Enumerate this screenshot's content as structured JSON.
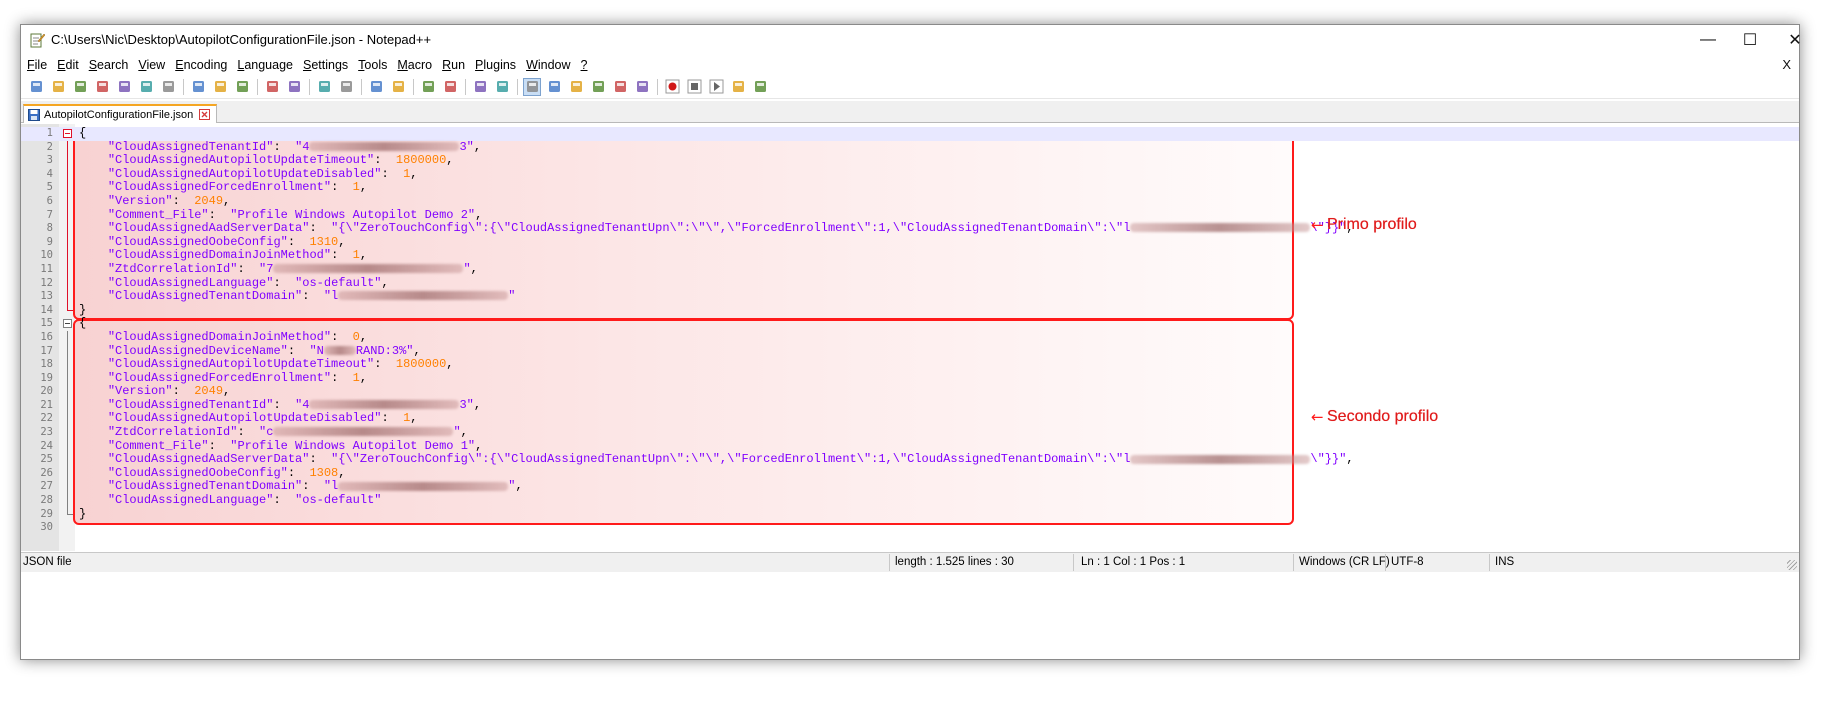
{
  "window": {
    "title": "C:\\Users\\Nic\\Desktop\\AutopilotConfigurationFile.json - Notepad++",
    "minimize": "—",
    "maximize": "☐",
    "close": "✕",
    "doc_close": "X"
  },
  "menu": [
    {
      "u": "F",
      "rest": "ile"
    },
    {
      "u": "E",
      "rest": "dit"
    },
    {
      "u": "S",
      "rest": "earch"
    },
    {
      "u": "V",
      "rest": "iew"
    },
    {
      "u": "E",
      "rest": "ncoding"
    },
    {
      "u": "L",
      "rest": "anguage"
    },
    {
      "u": "S",
      "rest": "ettings"
    },
    {
      "u": "T",
      "rest": "ools"
    },
    {
      "u": "M",
      "rest": "acro"
    },
    {
      "u": "R",
      "rest": "un"
    },
    {
      "u": "P",
      "rest": "lugins"
    },
    {
      "u": "W",
      "rest": "indow"
    },
    {
      "u": "?",
      "rest": ""
    }
  ],
  "toolbar_icons": [
    "new-file-icon",
    "open-file-icon",
    "save-icon",
    "save-all-icon",
    "close-icon",
    "close-all-icon",
    "print-icon",
    "|",
    "cut-icon",
    "copy-icon",
    "paste-icon",
    "|",
    "undo-icon",
    "redo-icon",
    "|",
    "find-icon",
    "replace-icon",
    "|",
    "zoom-in-icon",
    "zoom-out-icon",
    "|",
    "sync-vertical-icon",
    "sync-horizontal-icon",
    "|",
    "word-wrap-icon",
    "show-all-chars-icon",
    "|",
    "indent-guide-icon",
    "udl-icon",
    "doc-map-icon",
    "function-list-icon",
    "folder-workspace-icon",
    "monitor-icon",
    "|",
    "record-macro-icon",
    "stop-macro-icon",
    "play-macro-icon",
    "run-macro-multiple-icon",
    "save-macro-icon"
  ],
  "tab": {
    "label": "AutopilotConfigurationFile.json"
  },
  "code_lines": [
    [
      [
        "p",
        "{"
      ]
    ],
    [
      [
        "p",
        "    "
      ],
      [
        "k",
        "\"CloudAssignedTenantId\""
      ],
      [
        "p",
        ":  "
      ],
      [
        "k",
        "\"4"
      ],
      [
        "blur",
        "150"
      ],
      [
        "k",
        "3\""
      ],
      [
        "p",
        ","
      ]
    ],
    [
      [
        "p",
        "    "
      ],
      [
        "k",
        "\"CloudAssignedAutopilotUpdateTimeout\""
      ],
      [
        "p",
        ":  "
      ],
      [
        "n",
        "1800000"
      ],
      [
        "p",
        ","
      ]
    ],
    [
      [
        "p",
        "    "
      ],
      [
        "k",
        "\"CloudAssignedAutopilotUpdateDisabled\""
      ],
      [
        "p",
        ":  "
      ],
      [
        "n",
        "1"
      ],
      [
        "p",
        ","
      ]
    ],
    [
      [
        "p",
        "    "
      ],
      [
        "k",
        "\"CloudAssignedForcedEnrollment\""
      ],
      [
        "p",
        ":  "
      ],
      [
        "n",
        "1"
      ],
      [
        "p",
        ","
      ]
    ],
    [
      [
        "p",
        "    "
      ],
      [
        "k",
        "\"Version\""
      ],
      [
        "p",
        ":  "
      ],
      [
        "n",
        "2049"
      ],
      [
        "p",
        ","
      ]
    ],
    [
      [
        "p",
        "    "
      ],
      [
        "k",
        "\"Comment_File\""
      ],
      [
        "p",
        ":  "
      ],
      [
        "k",
        "\"Profile Windows Autopilot Demo 2\""
      ],
      [
        "p",
        ","
      ]
    ],
    [
      [
        "p",
        "    "
      ],
      [
        "k",
        "\"CloudAssignedAadServerData\""
      ],
      [
        "p",
        ":  "
      ],
      [
        "k",
        "\"{\\\"ZeroTouchConfig\\\":{\\\"CloudAssignedTenantUpn\\\":\\\"\\\",\\\"ForcedEnrollment\\\":1,\\\"CloudAssignedTenantDomain\\\":\\\"l"
      ],
      [
        "blur",
        "180"
      ],
      [
        "k",
        "\\\"}}\""
      ],
      [
        "p",
        ","
      ]
    ],
    [
      [
        "p",
        "    "
      ],
      [
        "k",
        "\"CloudAssignedOobeConfig\""
      ],
      [
        "p",
        ":  "
      ],
      [
        "n",
        "1310"
      ],
      [
        "p",
        ","
      ]
    ],
    [
      [
        "p",
        "    "
      ],
      [
        "k",
        "\"CloudAssignedDomainJoinMethod\""
      ],
      [
        "p",
        ":  "
      ],
      [
        "n",
        "1"
      ],
      [
        "p",
        ","
      ]
    ],
    [
      [
        "p",
        "    "
      ],
      [
        "k",
        "\"ZtdCorrelationId\""
      ],
      [
        "p",
        ":  "
      ],
      [
        "k",
        "\"7"
      ],
      [
        "blur",
        "190"
      ],
      [
        "k",
        "\""
      ],
      [
        "p",
        ","
      ]
    ],
    [
      [
        "p",
        "    "
      ],
      [
        "k",
        "\"CloudAssignedLanguage\""
      ],
      [
        "p",
        ":  "
      ],
      [
        "k",
        "\"os-default\""
      ],
      [
        "p",
        ","
      ]
    ],
    [
      [
        "p",
        "    "
      ],
      [
        "k",
        "\"CloudAssignedTenantDomain\""
      ],
      [
        "p",
        ":  "
      ],
      [
        "k",
        "\"l"
      ],
      [
        "blur",
        "170"
      ],
      [
        "k",
        "\""
      ]
    ],
    [
      [
        "p",
        "}"
      ]
    ],
    [
      [
        "p",
        "{"
      ]
    ],
    [
      [
        "p",
        "    "
      ],
      [
        "k",
        "\"CloudAssignedDomainJoinMethod\""
      ],
      [
        "p",
        ":  "
      ],
      [
        "n",
        "0"
      ],
      [
        "p",
        ","
      ]
    ],
    [
      [
        "p",
        "    "
      ],
      [
        "k",
        "\"CloudAssignedDeviceName\""
      ],
      [
        "p",
        ":  "
      ],
      [
        "k",
        "\"N"
      ],
      [
        "blur",
        "32"
      ],
      [
        "k",
        "RAND:3%\""
      ],
      [
        "p",
        ","
      ]
    ],
    [
      [
        "p",
        "    "
      ],
      [
        "k",
        "\"CloudAssignedAutopilotUpdateTimeout\""
      ],
      [
        "p",
        ":  "
      ],
      [
        "n",
        "1800000"
      ],
      [
        "p",
        ","
      ]
    ],
    [
      [
        "p",
        "    "
      ],
      [
        "k",
        "\"CloudAssignedForcedEnrollment\""
      ],
      [
        "p",
        ":  "
      ],
      [
        "n",
        "1"
      ],
      [
        "p",
        ","
      ]
    ],
    [
      [
        "p",
        "    "
      ],
      [
        "k",
        "\"Version\""
      ],
      [
        "p",
        ":  "
      ],
      [
        "n",
        "2049"
      ],
      [
        "p",
        ","
      ]
    ],
    [
      [
        "p",
        "    "
      ],
      [
        "k",
        "\"CloudAssignedTenantId\""
      ],
      [
        "p",
        ":  "
      ],
      [
        "k",
        "\"4"
      ],
      [
        "blur",
        "150"
      ],
      [
        "k",
        "3\""
      ],
      [
        "p",
        ","
      ]
    ],
    [
      [
        "p",
        "    "
      ],
      [
        "k",
        "\"CloudAssignedAutopilotUpdateDisabled\""
      ],
      [
        "p",
        ":  "
      ],
      [
        "n",
        "1"
      ],
      [
        "p",
        ","
      ]
    ],
    [
      [
        "p",
        "    "
      ],
      [
        "k",
        "\"ZtdCorrelationId\""
      ],
      [
        "p",
        ":  "
      ],
      [
        "k",
        "\"c"
      ],
      [
        "blur",
        "180"
      ],
      [
        "k",
        "\""
      ],
      [
        "p",
        ","
      ]
    ],
    [
      [
        "p",
        "    "
      ],
      [
        "k",
        "\"Comment_File\""
      ],
      [
        "p",
        ":  "
      ],
      [
        "k",
        "\"Profile Windows Autopilot Demo 1\""
      ],
      [
        "p",
        ","
      ]
    ],
    [
      [
        "p",
        "    "
      ],
      [
        "k",
        "\"CloudAssignedAadServerData\""
      ],
      [
        "p",
        ":  "
      ],
      [
        "k",
        "\"{\\\"ZeroTouchConfig\\\":{\\\"CloudAssignedTenantUpn\\\":\\\"\\\",\\\"ForcedEnrollment\\\":1,\\\"CloudAssignedTenantDomain\\\":\\\"l"
      ],
      [
        "blur",
        "180"
      ],
      [
        "k",
        "\\\"}}\""
      ],
      [
        "p",
        ","
      ]
    ],
    [
      [
        "p",
        "    "
      ],
      [
        "k",
        "\"CloudAssignedOobeConfig\""
      ],
      [
        "p",
        ":  "
      ],
      [
        "n",
        "1308"
      ],
      [
        "p",
        ","
      ]
    ],
    [
      [
        "p",
        "    "
      ],
      [
        "k",
        "\"CloudAssignedTenantDomain\""
      ],
      [
        "p",
        ":  "
      ],
      [
        "k",
        "\"l"
      ],
      [
        "blur",
        "170"
      ],
      [
        "k",
        "\""
      ],
      [
        "p",
        ","
      ]
    ],
    [
      [
        "p",
        "    "
      ],
      [
        "k",
        "\"CloudAssignedLanguage\""
      ],
      [
        "p",
        ":  "
      ],
      [
        "k",
        "\"os-default\""
      ]
    ],
    [
      [
        "p",
        "}"
      ]
    ],
    [
      [
        "p",
        ""
      ]
    ]
  ],
  "annotations": [
    {
      "label": "Primo profilo",
      "arrow": "←"
    },
    {
      "label": "Secondo profilo",
      "arrow": "←"
    }
  ],
  "status": {
    "type": "JSON file",
    "length": "length : 1.525    lines : 30",
    "position": "Ln : 1    Col : 1    Pos : 1",
    "eol": "Windows (CR LF)",
    "encoding": "UTF-8",
    "mode": "INS"
  },
  "colors": {
    "keyword": "#8000ff",
    "number": "#ff8000",
    "annotation": "#ff1a1a",
    "tab_accent": "#f5a623"
  }
}
